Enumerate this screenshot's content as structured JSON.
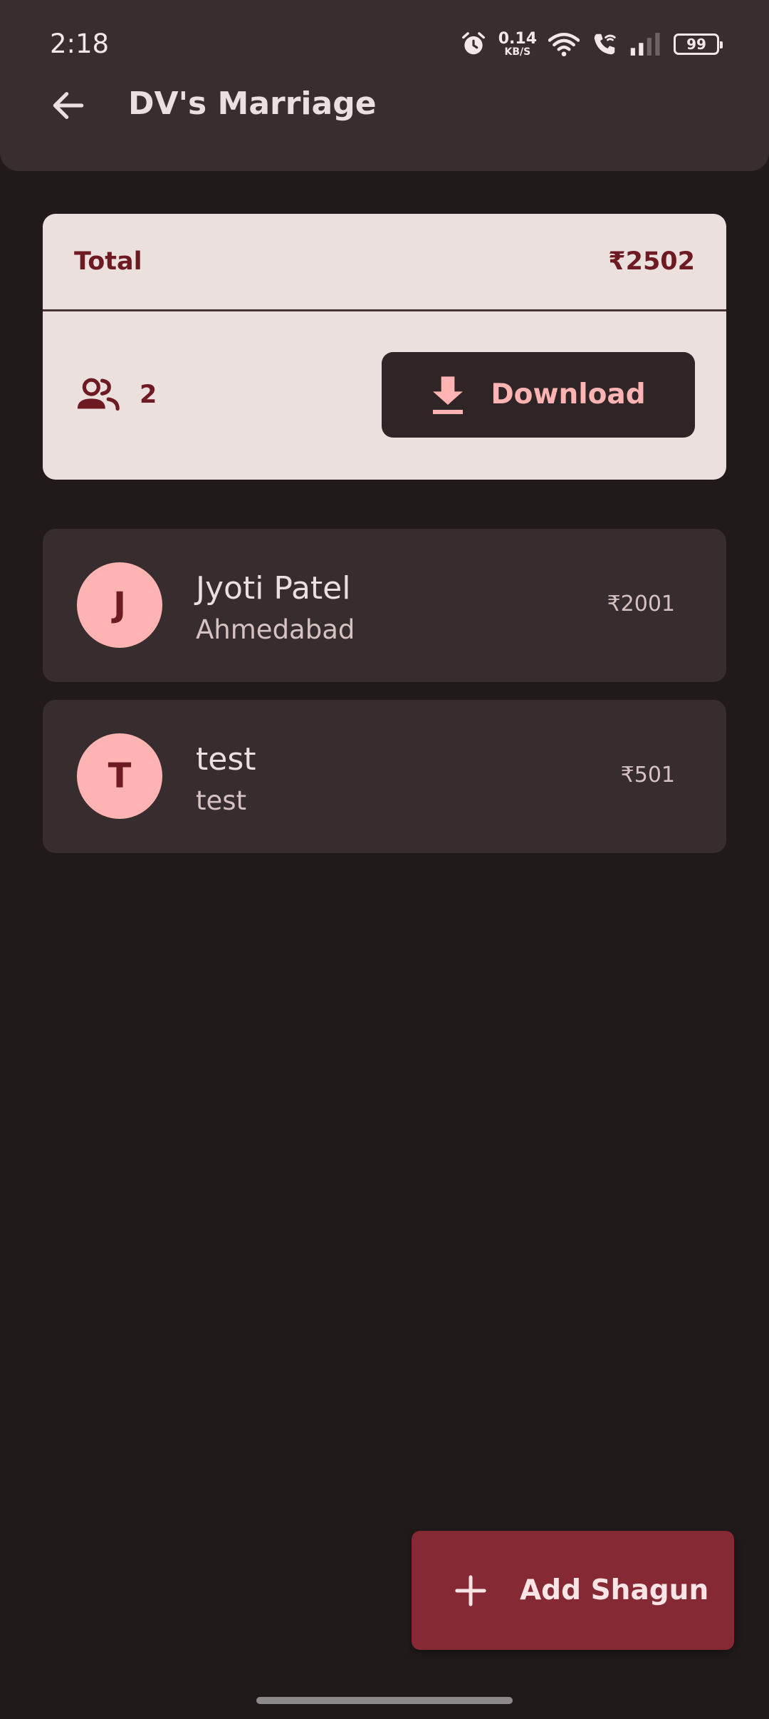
{
  "status_bar": {
    "time": "2:18",
    "net_speed_value": "0.14",
    "net_speed_unit": "KB/S",
    "battery": "99",
    "icons": [
      "alarm-icon",
      "wifi-icon",
      "wifi-calling-icon",
      "signal-icon",
      "battery-icon"
    ]
  },
  "header": {
    "title": "DV's Marriage",
    "back_icon": "arrow-left-icon"
  },
  "summary": {
    "total_label": "Total",
    "total_value": "₹2502",
    "people_icon": "people-icon",
    "people_count": "2",
    "download_label": "Download",
    "download_icon": "download-icon"
  },
  "entries": [
    {
      "initial": "J",
      "name": "Jyoti Patel",
      "city": "Ahmedabad",
      "amount": "₹2001"
    },
    {
      "initial": "T",
      "name": "test",
      "city": "test",
      "amount": "₹501"
    }
  ],
  "fab": {
    "label": "Add Shagun",
    "icon": "plus-icon"
  },
  "colors": {
    "background": "#201a1b",
    "surface": "#382d2e",
    "card": "#ece0df",
    "accent": "#ffb3b3",
    "primary_dark": "#6d1a23",
    "fab": "#852a35"
  }
}
